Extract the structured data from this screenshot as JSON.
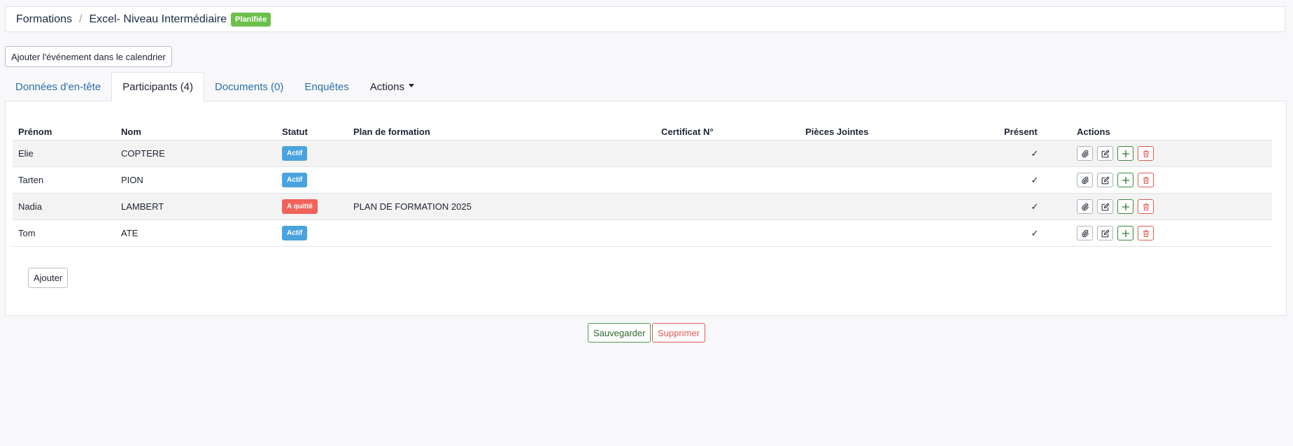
{
  "breadcrumb": {
    "root": "Formations",
    "separator": "/",
    "current": "Excel- Niveau Intermédiaire",
    "status": "Planifiée",
    "status_color": "#6cc04a"
  },
  "toolbar": {
    "calendar_label": "Ajouter l'événement dans le calendrier"
  },
  "tabs": [
    {
      "label": "Données d'en-tête"
    },
    {
      "label": "Participants (4)"
    },
    {
      "label": "Documents (0)"
    },
    {
      "label": "Enquêtes"
    },
    {
      "label": "Actions"
    }
  ],
  "table": {
    "headers": [
      "Prénom",
      "Nom",
      "Statut",
      "Plan de formation",
      "Certificat N°",
      "Pièces Jointes",
      "Présent",
      "Actions"
    ],
    "rows": [
      {
        "prenom": "Elie",
        "nom": "COPTERE",
        "statut": "Actif",
        "statut_color": "#4aa3df",
        "plan": "",
        "certificat": "",
        "pieces": "",
        "present": "✓"
      },
      {
        "prenom": "Tarten",
        "nom": "PION",
        "statut": "Actif",
        "statut_color": "#4aa3df",
        "plan": "",
        "certificat": "",
        "pieces": "",
        "present": "✓"
      },
      {
        "prenom": "Nadia",
        "nom": "LAMBERT",
        "statut": "A quitté",
        "statut_color": "#f0625a",
        "plan": "PLAN DE FORMATION 2025",
        "certificat": "",
        "pieces": "",
        "present": "✓"
      },
      {
        "prenom": "Tom",
        "nom": "ATE",
        "statut": "Actif",
        "statut_color": "#4aa3df",
        "plan": "",
        "certificat": "",
        "pieces": "",
        "present": "✓"
      }
    ],
    "row_action_icons": [
      "paperclip-icon",
      "edit-icon",
      "plus-icon",
      "trash-icon"
    ]
  },
  "panel": {
    "add_label": "Ajouter"
  },
  "footer": {
    "save_label": "Sauvegarder",
    "delete_label": "Supprimer"
  }
}
